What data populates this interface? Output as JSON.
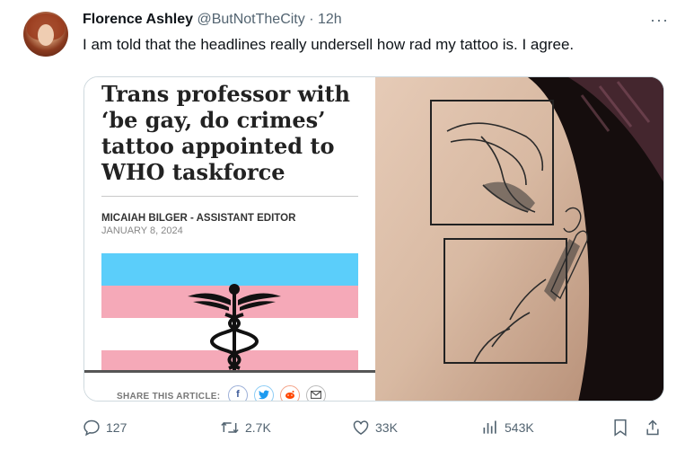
{
  "tweet": {
    "author_name": "Florence Ashley",
    "author_handle": "@ButNotTheCity",
    "separator": "·",
    "time": "12h",
    "more": "···",
    "text": "I am told that the headlines really undersell how rad my tattoo is. I agree."
  },
  "article": {
    "headline_lines": [
      "Trans professor with",
      "‘be gay, do crimes’",
      "tattoo appointed to",
      "WHO taskforce"
    ],
    "byline": "MICAIAH BILGER - ASSISTANT EDITOR",
    "date": "JANUARY 8, 2024",
    "share_label": "SHARE THIS ARTICLE:",
    "share_icons": [
      "facebook-icon",
      "twitter-icon",
      "reddit-icon",
      "email-icon"
    ],
    "flag_colors": {
      "blue": "#5bcefa",
      "pink": "#f5a9b8",
      "white": "#ffffff"
    }
  },
  "actions": {
    "replies": "127",
    "reposts": "2.7K",
    "likes": "33K",
    "views": "543K"
  },
  "colors": {
    "text": "#0f1419",
    "muted": "#536471",
    "border": "#cfd9de"
  }
}
